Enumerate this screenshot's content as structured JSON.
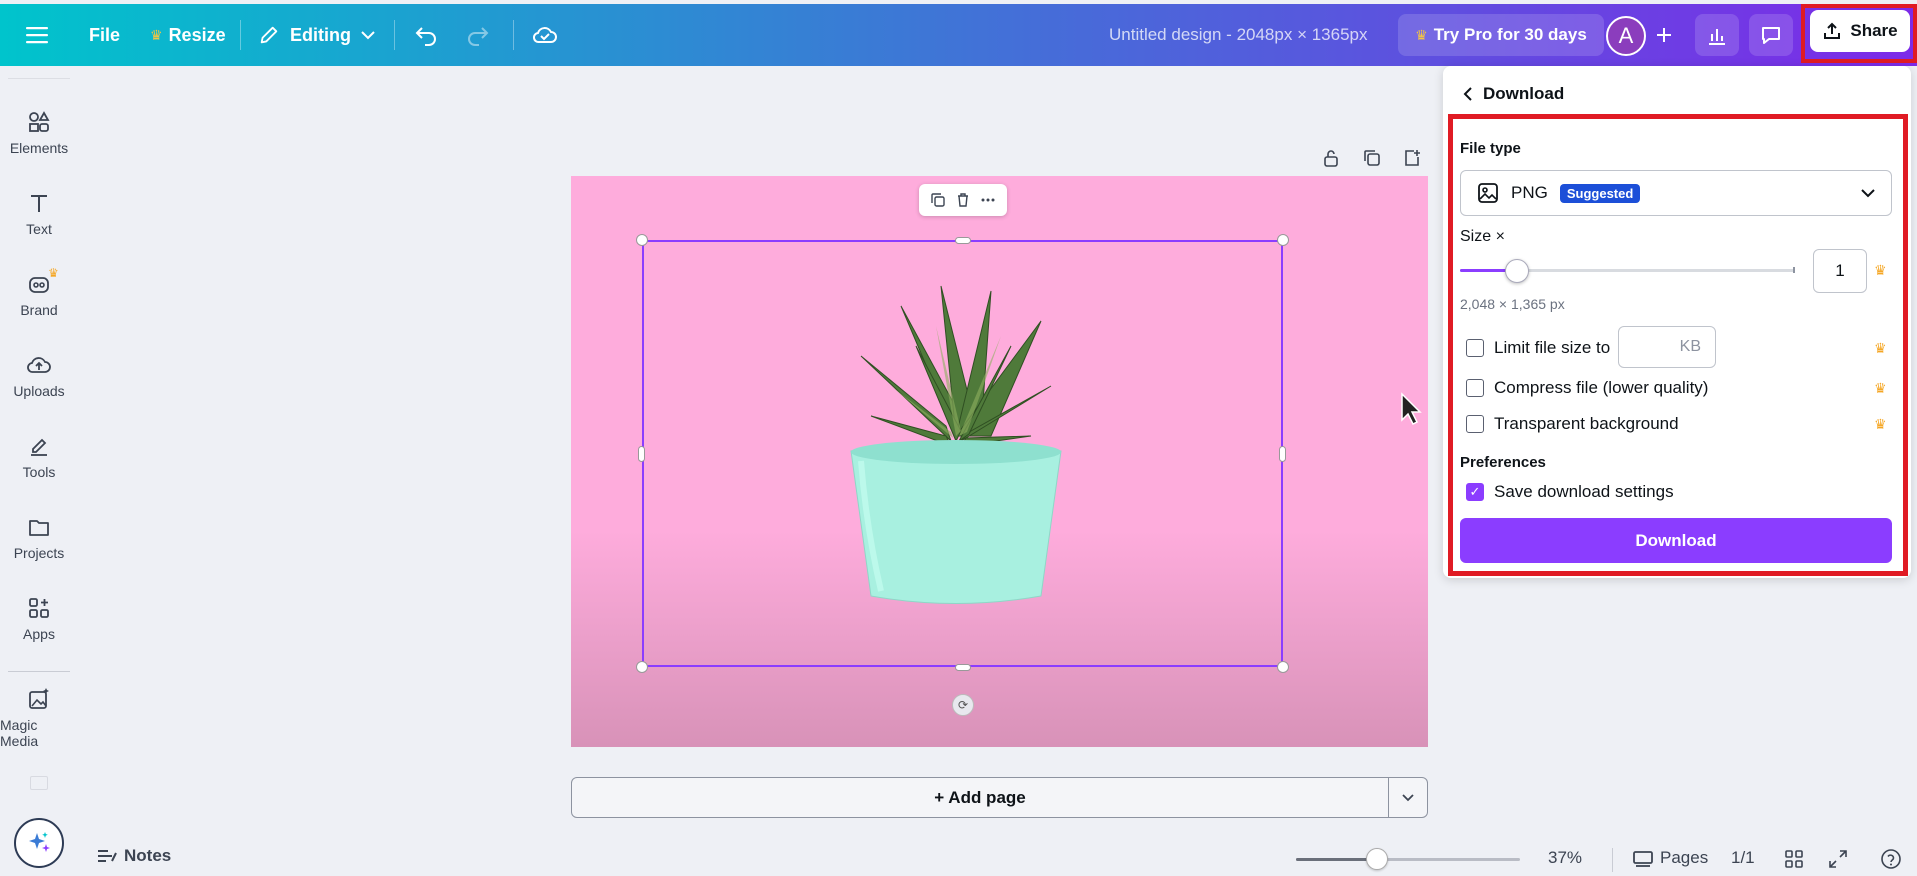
{
  "header": {
    "file_label": "File",
    "resize_label": "Resize",
    "editing_label": "Editing",
    "design_title": "Untitled design - 2048px × 1365px",
    "try_pro_label": "Try Pro for 30 days",
    "avatar_initial": "A",
    "share_label": "Share"
  },
  "sidebar": {
    "items": [
      {
        "label": "Elements",
        "icon": "elements-icon"
      },
      {
        "label": "Text",
        "icon": "text-icon"
      },
      {
        "label": "Brand",
        "icon": "brand-icon"
      },
      {
        "label": "Uploads",
        "icon": "uploads-icon"
      },
      {
        "label": "Tools",
        "icon": "tools-icon"
      },
      {
        "label": "Projects",
        "icon": "projects-icon"
      },
      {
        "label": "Apps",
        "icon": "apps-icon"
      },
      {
        "label": "Magic Media",
        "icon": "magic-media-icon"
      }
    ]
  },
  "canvas": {
    "add_page_label": "+ Add page"
  },
  "bottom": {
    "notes_label": "Notes",
    "zoom_value": "37%",
    "zoom_fraction": 0.36,
    "pages_label": "Pages",
    "page_count": "1/1"
  },
  "download_panel": {
    "title": "Download",
    "file_type_label": "File type",
    "file_type_value": "PNG",
    "suggested_badge": "Suggested",
    "size_label": "Size ×",
    "size_value": "1",
    "size_slider_fraction": 0.17,
    "dimensions_text": "2,048 × 1,365 px",
    "limit_file_size_label": "Limit file size to",
    "kb_placeholder": "KB",
    "compress_label": "Compress file (lower quality)",
    "transparent_label": "Transparent background",
    "preferences_label": "Preferences",
    "save_settings_label": "Save download settings",
    "save_settings_checked": true,
    "download_button_label": "Download"
  },
  "colors": {
    "accent": "#8b3dff",
    "highlight": "#e01b24",
    "canvas_bg": "#feacdc"
  }
}
